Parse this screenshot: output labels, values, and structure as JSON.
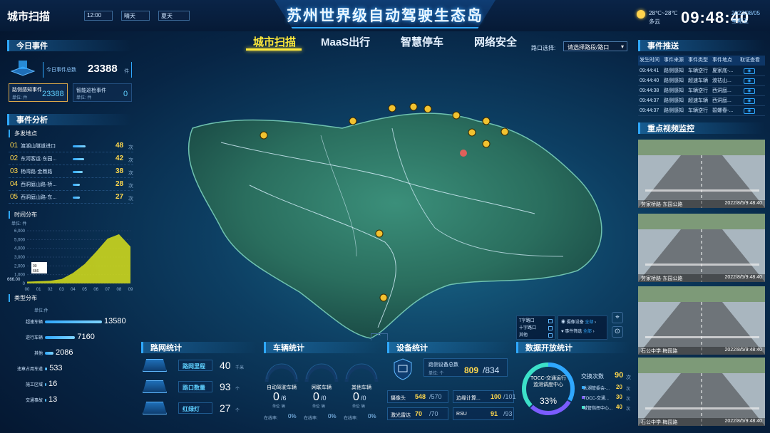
{
  "app_title": "城市扫描",
  "filters": {
    "time": "12:00",
    "weather": "晴天",
    "season": "夏天"
  },
  "main_title": "苏州世界级自动驾驶生态岛",
  "weather_info": {
    "temp": "28℃~28℃",
    "desc": "多云"
  },
  "clock": {
    "time": "09:48:40",
    "date": "2022/08/05",
    "weekday": "星期五"
  },
  "nav": {
    "tabs": [
      "城市扫描",
      "MaaS出行",
      "智慧停车",
      "网络安全"
    ],
    "active": 0
  },
  "crossing": {
    "label": "路口选择:",
    "placeholder": "请选择路段/路口"
  },
  "today_events": {
    "title": "今日事件",
    "total_label": "今日事件总数",
    "total_value": "23388",
    "total_unit": "件",
    "perception_label": "路侧感知事件",
    "perception_unit": "单位: 件",
    "perception_value": "23388",
    "patrol_label": "智能巡检事件",
    "patrol_unit": "单位: 件",
    "patrol_value": "0"
  },
  "analysis": {
    "title": "事件分析",
    "hotspots_title": "多发地点",
    "unit": "次",
    "hotspots": [
      {
        "rank": "01",
        "name": "渡湖山隧道进口",
        "value": "48",
        "pct": 100
      },
      {
        "rank": "02",
        "name": "东河客运·东园...",
        "value": "42",
        "pct": 87
      },
      {
        "rank": "03",
        "name": "杨湾路·金鼎路",
        "value": "38",
        "pct": 79
      },
      {
        "rank": "04",
        "name": "西洞庭山路·桥...",
        "value": "28",
        "pct": 58
      },
      {
        "rank": "05",
        "name": "西洞庭山路·东...",
        "value": "27",
        "pct": 56
      }
    ]
  },
  "time_dist": {
    "title": "时间分布",
    "unit_label": "单位: 件",
    "tooltip_a": "00",
    "tooltip_b": "666",
    "corner_label": "666.00"
  },
  "chart_data": {
    "type": "area",
    "x": [
      "00",
      "01",
      "02",
      "03",
      "04",
      "05",
      "06",
      "07",
      "08",
      "09"
    ],
    "values": [
      200,
      250,
      300,
      500,
      1200,
      2200,
      3600,
      5100,
      5600,
      4200
    ],
    "ylim": [
      0,
      6000
    ],
    "yticks": [
      "6,000",
      "5,000",
      "4,000",
      "3,000",
      "2,000",
      "1,000",
      "0"
    ]
  },
  "type_dist": {
    "title": "类型分布",
    "unit_label": "单位:件",
    "items": [
      {
        "name": "超速车辆",
        "value": "13580",
        "pct": 100
      },
      {
        "name": "逆行车辆",
        "value": "7160",
        "pct": 53
      },
      {
        "name": "其他",
        "value": "2086",
        "pct": 15
      },
      {
        "name": "违章占用车道",
        "value": "533",
        "pct": 4
      },
      {
        "name": "施工区域",
        "value": "16",
        "pct": 0
      },
      {
        "name": "交通事故",
        "value": "13",
        "pct": 0
      }
    ]
  },
  "event_push": {
    "title": "事件推送",
    "headers": [
      "发生时间",
      "事件来源",
      "事件类型",
      "事件地点",
      "取证查看"
    ],
    "rows": [
      {
        "time": "09:44:41",
        "source": "路侧感知",
        "type": "车辆逆行",
        "place": "夏家底-..."
      },
      {
        "time": "09:44:40",
        "source": "路侧感知",
        "type": "超速车辆",
        "place": "渡祜山..."
      },
      {
        "time": "09:44:38",
        "source": "路侧感知",
        "type": "车辆逆行",
        "place": "西洞庭..."
      },
      {
        "time": "09:44:37",
        "source": "路侧感知",
        "type": "超速车辆",
        "place": "西洞庭..."
      },
      {
        "time": "09:44:37",
        "source": "路侧感知",
        "type": "车辆逆行",
        "place": "碧螺春-..."
      }
    ]
  },
  "video": {
    "title": "重点视频监控",
    "cams": [
      {
        "name": "劳家桥路·东园公路",
        "time": "2022/8/5/9:48:40"
      },
      {
        "name": "劳家桥路·东园公路",
        "time": "2022/8/5/9:48:40"
      },
      {
        "name": "石公中学·梅园路",
        "time": "2022/8/5/9:48:40"
      },
      {
        "name": "石公中学·梅园路",
        "time": "2022/8/5/9:48:40"
      }
    ]
  },
  "legend": {
    "items": [
      "T字路口",
      "十字路口",
      "其他"
    ],
    "camera": "摄像设备",
    "camera_action": "全部",
    "filter": "事件筛选",
    "filter_action": "全部"
  },
  "road_stats": {
    "title": "路网统计",
    "items": [
      {
        "label": "路网里程",
        "value": "40",
        "unit": "千米"
      },
      {
        "label": "路口数量",
        "value": "93",
        "unit": "个"
      },
      {
        "label": "红绿灯",
        "value": "27",
        "unit": "个"
      }
    ]
  },
  "vehicle_stats": {
    "title": "车辆统计",
    "gauges": [
      {
        "label": "自动驾驶车辆",
        "value": "0",
        "total": "/6",
        "unit": "单位: 辆",
        "rate_label": "在线率:",
        "rate": "0%"
      },
      {
        "label": "网联车辆",
        "value": "0",
        "total": "/0",
        "unit": "单位: 辆",
        "rate_label": "在线率:",
        "rate": "0%"
      },
      {
        "label": "其他车辆",
        "value": "0",
        "total": "/0",
        "unit": "单位: 辆",
        "rate_label": "在线率:",
        "rate": "0%"
      }
    ]
  },
  "device_stats": {
    "title": "设备统计",
    "total_label": "路侧设备总数",
    "total_unit": "单位: 个",
    "total_value": "809",
    "total_max": "/834",
    "items": [
      {
        "label": "摄像头",
        "value": "548",
        "max": "/570"
      },
      {
        "label": "边缘计算...",
        "value": "100",
        "max": "/101"
      },
      {
        "label": "激光雷达",
        "value": "70",
        "max": "/70"
      },
      {
        "label": "RSU",
        "value": "91",
        "max": "/93"
      }
    ]
  },
  "open_stats": {
    "title": "数据开放统计",
    "center_label": "TOCC-交通运行监测调度中心",
    "center_pct": "33%",
    "exchange_label": "交换次数",
    "exchange_value": "90",
    "unit": "次",
    "items": [
      {
        "name": "太湖管委会-...",
        "value": "20",
        "color": "#2fa8ff"
      },
      {
        "name": "TOCC-交通...",
        "value": "30",
        "color": "#7b5cff"
      },
      {
        "name": "城管指挥中心...",
        "value": "40",
        "color": "#3ce0c8"
      }
    ]
  }
}
